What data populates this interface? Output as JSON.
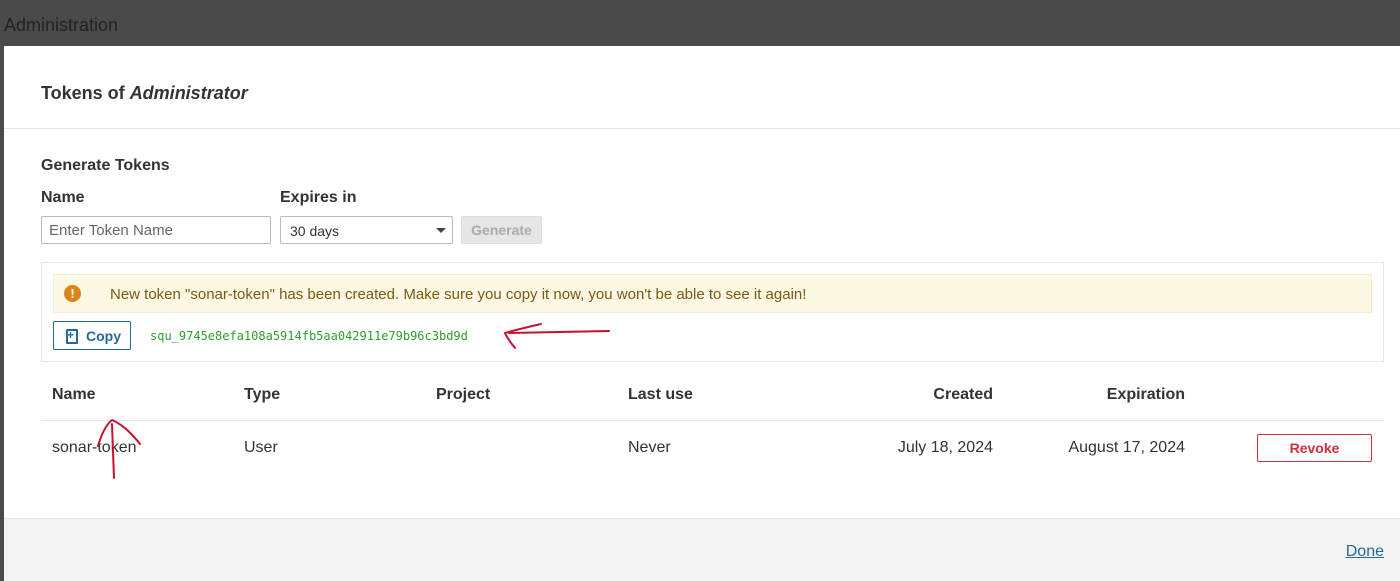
{
  "background": {
    "title": "Administration"
  },
  "modal": {
    "title_prefix": "Tokens of ",
    "title_user": "Administrator"
  },
  "generate": {
    "section_title": "Generate Tokens",
    "name_label": "Name",
    "name_placeholder": "Enter Token Name",
    "name_value": "",
    "expires_label": "Expires in",
    "expires_value": "30 days",
    "generate_label": "Generate"
  },
  "new_token": {
    "alert_icon": "!",
    "alert_text": "New token \"sonar-token\" has been created. Make sure you copy it now, you won't be able to see it again!",
    "copy_label": "Copy",
    "token_value": "squ_9745e8efa108a5914fb5aa042911e79b96c3bd9d"
  },
  "tokens_table": {
    "headers": {
      "name": "Name",
      "type": "Type",
      "project": "Project",
      "last_use": "Last use",
      "created": "Created",
      "expiration": "Expiration"
    },
    "rows": [
      {
        "name": "sonar-token",
        "type": "User",
        "project": "",
        "last_use": "Never",
        "created": "July 18, 2024",
        "expiration": "August 17, 2024",
        "action": "Revoke"
      }
    ]
  },
  "footer": {
    "done_label": "Done"
  },
  "colors": {
    "primary": "#236a97",
    "danger": "#d02f3a",
    "warning_bg": "#fcf8e3",
    "warning_icon": "#e0821b",
    "token_green": "#2f9e2f",
    "annotation_red": "#c8102e"
  },
  "icons": {
    "alert": "exclamation-circle-icon",
    "copy": "clipboard-copy-icon",
    "select": "chevron-down-icon"
  }
}
